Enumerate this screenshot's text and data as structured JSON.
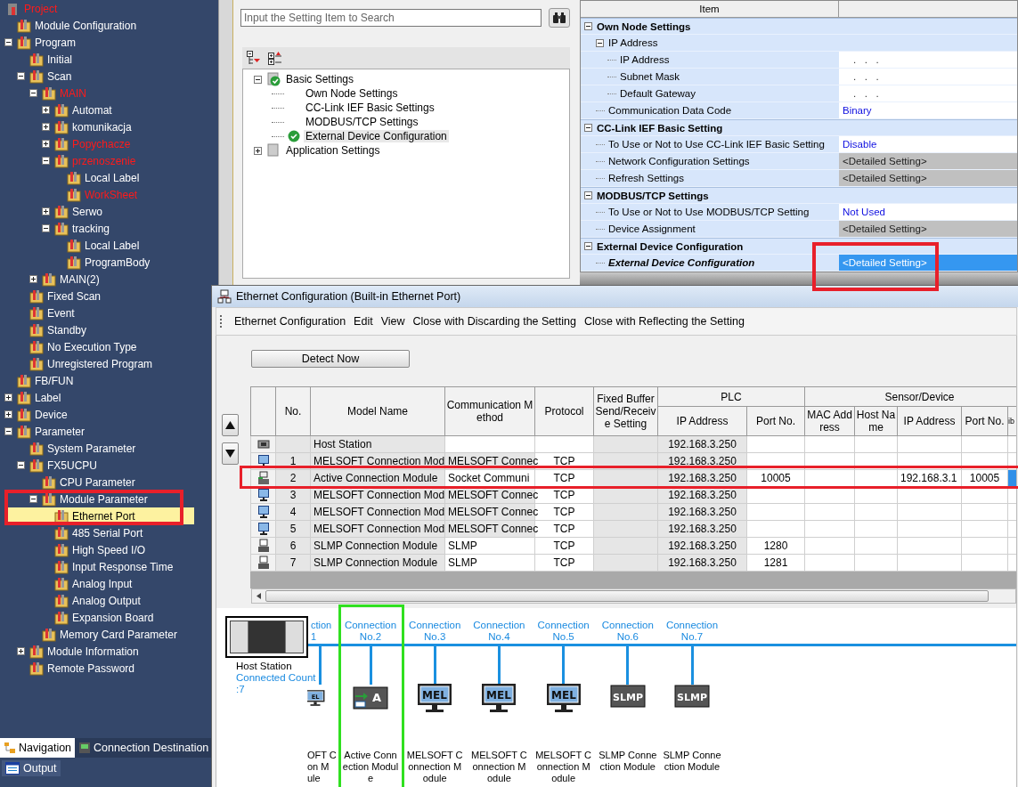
{
  "nav": {
    "project": {
      "label": "Project",
      "color": "#ff1a1a"
    },
    "items": [
      {
        "label": "Module Configuration",
        "selected": false
      },
      {
        "label": "Program",
        "selected": false,
        "expanded": true,
        "children": [
          {
            "label": "Initial",
            "selected": false
          },
          {
            "label": "Scan",
            "selected": false,
            "expanded": true,
            "children": [
              {
                "label": "MAIN",
                "selected": false,
                "color": "#ff1a1a",
                "expanded": true,
                "children": [
                  {
                    "label": "Automat",
                    "selected": false,
                    "expanded": false
                  },
                  {
                    "label": "komunikacja",
                    "selected": false,
                    "expanded": false
                  },
                  {
                    "label": "Popychacze",
                    "selected": false,
                    "color": "#ff1a1a",
                    "expanded": false
                  },
                  {
                    "label": "przenoszenie",
                    "selected": false,
                    "color": "#ff1a1a",
                    "expanded": true,
                    "children": [
                      {
                        "label": "Local Label",
                        "selected": false
                      },
                      {
                        "label": "WorkSheet",
                        "selected": false,
                        "color": "#ff1a1a"
                      }
                    ]
                  },
                  {
                    "label": "Serwo",
                    "selected": false,
                    "expanded": false
                  },
                  {
                    "label": "tracking",
                    "selected": false,
                    "expanded": true,
                    "children": [
                      {
                        "label": "Local Label",
                        "selected": false
                      },
                      {
                        "label": "ProgramBody",
                        "selected": false
                      }
                    ]
                  }
                ]
              },
              {
                "label": "MAIN(2)",
                "selected": false,
                "expanded": false
              }
            ]
          },
          {
            "label": "Fixed Scan",
            "selected": false
          },
          {
            "label": "Event",
            "selected": false
          },
          {
            "label": "Standby",
            "selected": false
          },
          {
            "label": "No Execution Type",
            "selected": false
          },
          {
            "label": "Unregistered Program",
            "selected": false
          }
        ]
      },
      {
        "label": "FB/FUN",
        "selected": false
      },
      {
        "label": "Label",
        "selected": false,
        "expanded": false
      },
      {
        "label": "Device",
        "selected": false,
        "expanded": false
      },
      {
        "label": "Parameter",
        "selected": false,
        "expanded": true,
        "children": [
          {
            "label": "System Parameter",
            "selected": false
          },
          {
            "label": "FX5UCPU",
            "selected": false,
            "expanded": true,
            "children": [
              {
                "label": "CPU Parameter",
                "selected": false
              },
              {
                "label": "Module Parameter",
                "selected": false,
                "expanded": true,
                "children": [
                  {
                    "label": "Ethernet Port",
                    "selected": true
                  },
                  {
                    "label": "485 Serial Port",
                    "selected": false
                  },
                  {
                    "label": "High Speed I/O",
                    "selected": false
                  },
                  {
                    "label": "Input Response Time",
                    "selected": false
                  },
                  {
                    "label": "Analog Input",
                    "selected": false
                  },
                  {
                    "label": "Analog Output",
                    "selected": false
                  },
                  {
                    "label": "Expansion Board",
                    "selected": false
                  }
                ]
              },
              {
                "label": "Memory Card Parameter",
                "selected": false
              }
            ]
          },
          {
            "label": "Module Information",
            "selected": false,
            "expanded": false
          },
          {
            "label": "Remote Password",
            "selected": false
          }
        ]
      }
    ],
    "tabs": [
      {
        "label": "Navigation",
        "selected": true
      },
      {
        "label": "Connection Destination",
        "selected": false
      }
    ],
    "output_tab": {
      "label": "Output"
    }
  },
  "settings": {
    "search": {
      "placeholder": "Input the Setting Item to Search"
    },
    "tree": [
      {
        "label": "Basic Settings",
        "expanded": true,
        "checked": true,
        "selected": false,
        "children": [
          {
            "label": "Own Node Settings",
            "checked": false,
            "selected": false
          },
          {
            "label": "CC-Link IEF Basic Settings",
            "checked": false,
            "selected": false
          },
          {
            "label": "MODBUS/TCP Settings",
            "checked": false,
            "selected": false
          },
          {
            "label": "External Device Configuration",
            "checked": true,
            "selected": true
          }
        ]
      },
      {
        "label": "Application Settings",
        "expanded": false,
        "checked": false,
        "selected": false
      }
    ]
  },
  "grid": {
    "column_header": "Item",
    "sections": [
      {
        "label": "Own Node Settings",
        "expanded": true,
        "items": [
          {
            "label": "IP Address",
            "expanded": true,
            "selected": false,
            "children": [
              {
                "label": "IP Address",
                "value": ".   .   .",
                "kind": "plain",
                "selected": false
              },
              {
                "label": "Subnet Mask",
                "value": ".   .   .",
                "kind": "plain",
                "selected": false
              },
              {
                "label": "Default Gateway",
                "value": ".   .   .",
                "kind": "plain",
                "selected": false
              }
            ]
          },
          {
            "label": "Communication Data Code",
            "value": "Binary",
            "kind": "text",
            "selected": false
          }
        ]
      },
      {
        "label": "CC-Link IEF Basic Setting",
        "expanded": true,
        "items": [
          {
            "label": "To Use or Not to Use CC-Link IEF Basic Setting",
            "value": "Disable",
            "kind": "text",
            "selected": false
          },
          {
            "label": "Network Configuration Settings",
            "value": "<Detailed Setting>",
            "kind": "button",
            "selected": false
          },
          {
            "label": "Refresh Settings",
            "value": "<Detailed Setting>",
            "kind": "button",
            "selected": false
          }
        ]
      },
      {
        "label": "MODBUS/TCP Settings",
        "expanded": true,
        "items": [
          {
            "label": "To Use or Not to Use MODBUS/TCP Setting",
            "value": "Not Used",
            "kind": "text",
            "selected": false
          },
          {
            "label": "Device Assignment",
            "value": "<Detailed Setting>",
            "kind": "button",
            "selected": false
          }
        ]
      },
      {
        "label": "External Device Configuration",
        "expanded": true,
        "items": [
          {
            "label": "External Device Configuration",
            "value": "<Detailed Setting>",
            "kind": "button",
            "selected": true
          }
        ]
      }
    ]
  },
  "dialog": {
    "title": "Ethernet Configuration (Built-in Ethernet Port)",
    "menu": [
      "Ethernet Configuration",
      "Edit",
      "View",
      "Close with Discarding the Setting",
      "Close with Reflecting the Setting"
    ],
    "detect_button": "Detect Now",
    "column_groups": [
      "PLC",
      "Sensor/Device"
    ],
    "columns": [
      "No.",
      "Model Name",
      "Communication Method",
      "Protocol",
      "Fixed Buffer Send/Receive Setting",
      "IP Address",
      "Port No.",
      "MAC Address",
      "Host Name",
      "IP Address",
      "Port No.",
      "ib"
    ],
    "rows": [
      {
        "kind": "host",
        "model": "Host Station",
        "plc_ip": "192.168.3.250",
        "selected": false
      },
      {
        "kind": "mel",
        "no": "1",
        "model": "MELSOFT Connection Mod",
        "method": "MELSOFT Connec",
        "protocol": "TCP",
        "plc_ip": "192.168.3.250",
        "selected": false
      },
      {
        "kind": "active",
        "no": "2",
        "model": "Active Connection Module",
        "method": "Socket Communi",
        "protocol": "TCP",
        "plc_ip": "192.168.3.250",
        "plc_port": "10005",
        "ip": "192.168.3.1",
        "port": "10005",
        "selected": true
      },
      {
        "kind": "mel",
        "no": "3",
        "model": "MELSOFT Connection Mod",
        "method": "MELSOFT Connec",
        "protocol": "TCP",
        "plc_ip": "192.168.3.250",
        "selected": false
      },
      {
        "kind": "mel",
        "no": "4",
        "model": "MELSOFT Connection Mod",
        "method": "MELSOFT Connec",
        "protocol": "TCP",
        "plc_ip": "192.168.3.250",
        "selected": false
      },
      {
        "kind": "mel",
        "no": "5",
        "model": "MELSOFT Connection Mod",
        "method": "MELSOFT Connec",
        "protocol": "TCP",
        "plc_ip": "192.168.3.250",
        "selected": false
      },
      {
        "kind": "slmp",
        "no": "6",
        "model": "SLMP Connection Module",
        "method": "SLMP",
        "protocol": "TCP",
        "plc_ip": "192.168.3.250",
        "plc_port": "1280",
        "selected": false
      },
      {
        "kind": "slmp",
        "no": "7",
        "model": "SLMP Connection Module",
        "method": "SLMP",
        "protocol": "TCP",
        "plc_ip": "192.168.3.250",
        "plc_port": "1281",
        "selected": false
      }
    ],
    "host": {
      "label": "Host Station",
      "count": "Connected Count :7"
    },
    "connections": [
      {
        "kind": "mel",
        "badge": "EL",
        "label": [
          "ction",
          "1"
        ],
        "name": [
          "OFT C",
          "on M",
          "ule"
        ]
      },
      {
        "kind": "active",
        "badge": "A",
        "label": [
          "Connection",
          "No.2"
        ],
        "name": [
          "Active Conn",
          "ection Modul",
          "e"
        ]
      },
      {
        "kind": "mel",
        "badge": "MEL",
        "label": [
          "Connection",
          "No.3"
        ],
        "name": [
          "MELSOFT C",
          "onnection M",
          "odule"
        ]
      },
      {
        "kind": "mel",
        "badge": "MEL",
        "label": [
          "Connection",
          "No.4"
        ],
        "name": [
          "MELSOFT C",
          "onnection M",
          "odule"
        ]
      },
      {
        "kind": "mel",
        "badge": "MEL",
        "label": [
          "Connection",
          "No.5"
        ],
        "name": [
          "MELSOFT C",
          "onnection M",
          "odule"
        ]
      },
      {
        "kind": "slmp",
        "badge": "SLMP",
        "label": [
          "Connection",
          "No.6"
        ],
        "name": [
          "SLMP Conne",
          "ction Module"
        ]
      },
      {
        "kind": "slmp",
        "badge": "SLMP",
        "label": [
          "Connection",
          "No.7"
        ],
        "name": [
          "SLMP Conne",
          "ction Module"
        ]
      }
    ]
  }
}
